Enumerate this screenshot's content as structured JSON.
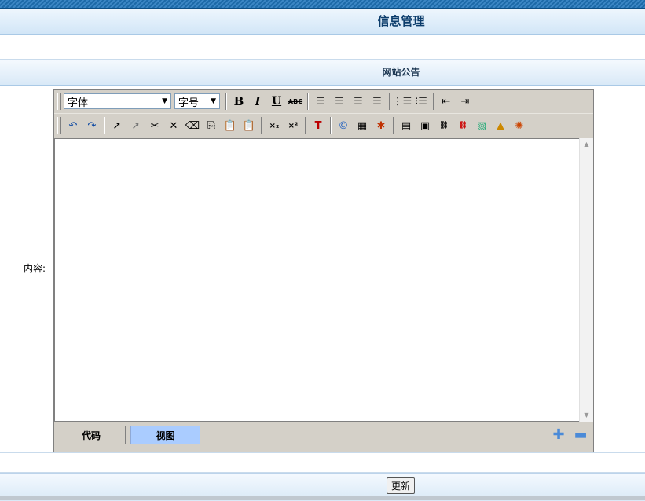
{
  "header": {
    "title": "信息管理"
  },
  "section": {
    "title": "网站公告"
  },
  "form": {
    "content_label": "内容:"
  },
  "editor": {
    "font_select": "字体",
    "size_select": "字号",
    "toolbar1": {
      "bold": "B",
      "italic": "I",
      "underline": "U",
      "strike": "ABC"
    },
    "toolbar2": {
      "subscript": "×₂",
      "superscript": "×²"
    },
    "mode_code": "代码",
    "mode_view": "视图"
  },
  "footer": {
    "submit_label": "更新"
  }
}
